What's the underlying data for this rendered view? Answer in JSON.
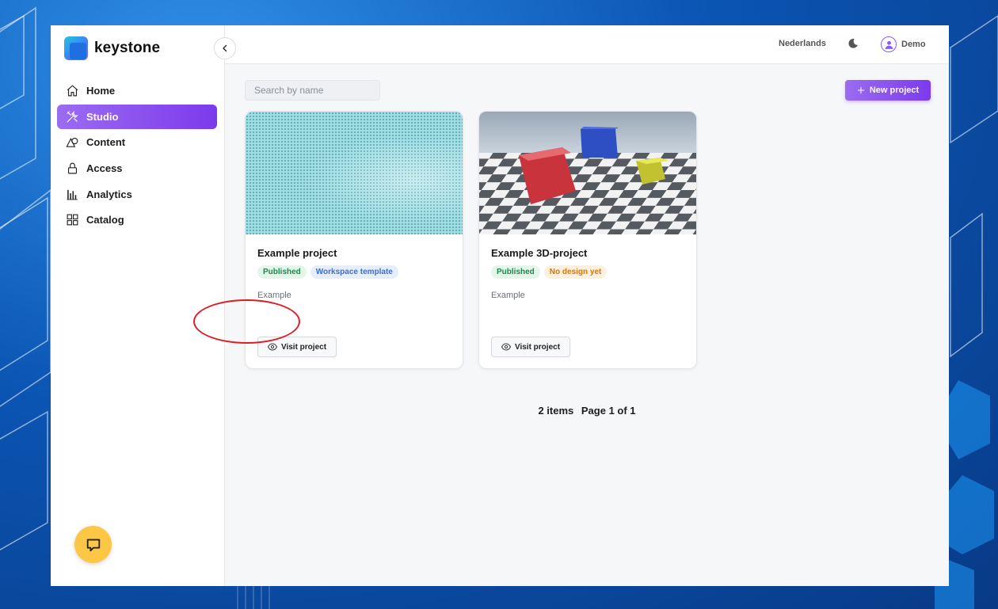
{
  "brand": {
    "name": "keystone"
  },
  "sidebar": {
    "items": [
      {
        "label": "Home",
        "icon": "home-icon",
        "active": false
      },
      {
        "label": "Studio",
        "icon": "tools-icon",
        "active": true
      },
      {
        "label": "Content",
        "icon": "shapes-icon",
        "active": false
      },
      {
        "label": "Access",
        "icon": "lock-icon",
        "active": false
      },
      {
        "label": "Analytics",
        "icon": "bar-chart-icon",
        "active": false
      },
      {
        "label": "Catalog",
        "icon": "grid-icon",
        "active": false
      }
    ]
  },
  "topbar": {
    "language": "Nederlands",
    "theme_icon": "moon-icon",
    "user_name": "Demo"
  },
  "toolbar": {
    "search_placeholder": "Search by name",
    "new_project_label": "New project"
  },
  "projects": [
    {
      "title": "Example project",
      "badges": [
        {
          "label": "Published",
          "tone": "green"
        },
        {
          "label": "Workspace template",
          "tone": "blue"
        }
      ],
      "description": "Example",
      "visit_label": "Visit project"
    },
    {
      "title": "Example 3D-project",
      "badges": [
        {
          "label": "Published",
          "tone": "green"
        },
        {
          "label": "No design yet",
          "tone": "orange"
        }
      ],
      "description": "Example",
      "visit_label": "Visit project"
    }
  ],
  "pagination": {
    "items_text": "2 items",
    "page_text": "Page 1 of 1"
  },
  "colors": {
    "accent": "#7c3aed",
    "highlight": "#dd1c24",
    "chat": "#fcc745"
  }
}
